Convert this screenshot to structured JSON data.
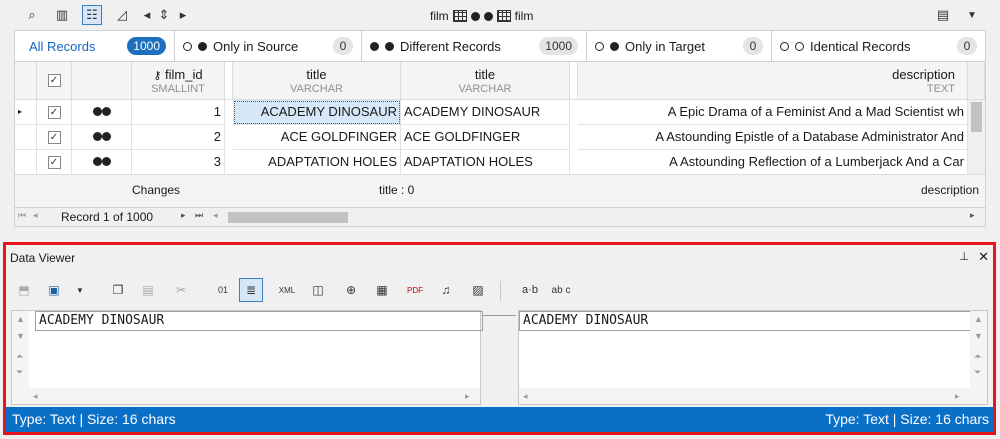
{
  "toolbar": {
    "left_table": "film",
    "right_table": "film"
  },
  "filters": [
    {
      "label": "All Records",
      "count": "1000"
    },
    {
      "label": "Only in Source",
      "count": "0"
    },
    {
      "label": "Different Records",
      "count": "1000"
    },
    {
      "label": "Only in Target",
      "count": "0"
    },
    {
      "label": "Identical Records",
      "count": "0"
    }
  ],
  "columns": {
    "film_id": {
      "name": "film_id",
      "type": "SMALLINT"
    },
    "title_src": {
      "name": "title",
      "type": "VARCHAR"
    },
    "title_tgt": {
      "name": "title",
      "type": "VARCHAR"
    },
    "description": {
      "name": "description",
      "type": "TEXT"
    }
  },
  "rows": [
    {
      "id": "1",
      "title_src": "ACADEMY DINOSAUR",
      "title_tgt": "ACADEMY DINOSAUR",
      "description": "A Epic Drama of a Feminist And a Mad Scientist wh"
    },
    {
      "id": "2",
      "title_src": "ACE GOLDFINGER",
      "title_tgt": "ACE GOLDFINGER",
      "description": "A Astounding Epistle of a Database Administrator And"
    },
    {
      "id": "3",
      "title_src": "ADAPTATION HOLES",
      "title_tgt": "ADAPTATION HOLES",
      "description": "A Astounding Reflection of a Lumberjack And a Car"
    }
  ],
  "summary": {
    "changes": "Changes",
    "title": "title : 0",
    "description": "description"
  },
  "navigator": {
    "record": "Record 1 of 1000"
  },
  "data_viewer": {
    "title": "Data Viewer",
    "left_value": "ACADEMY DINOSAUR",
    "right_value": "ACADEMY DINOSAUR",
    "status_left": "Type: Text | Size: 16 chars",
    "status_right": "Type: Text | Size: 16 chars",
    "format_text": "a·b",
    "format_abc": "ab c"
  }
}
